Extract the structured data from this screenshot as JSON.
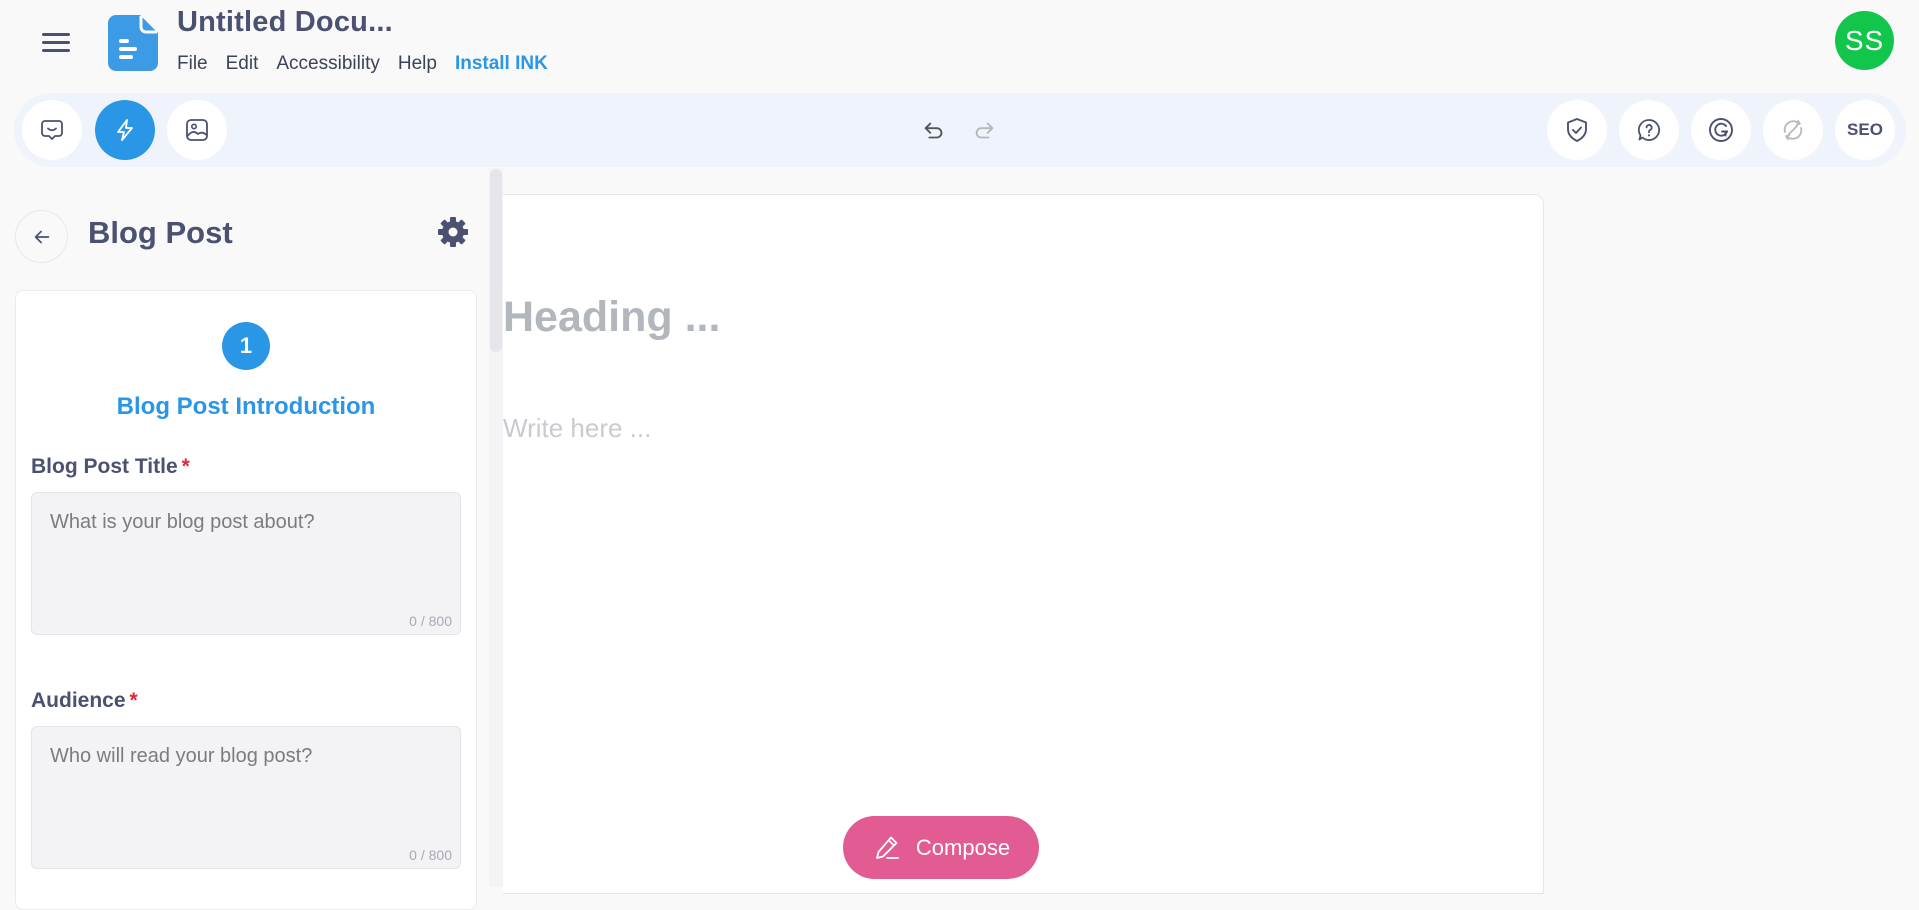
{
  "header": {
    "doc_title": "Untitled Docu...",
    "menu": [
      "File",
      "Edit",
      "Accessibility",
      "Help",
      "Install INK"
    ],
    "avatar_initials": "SS",
    "avatar_color": "#12c64b",
    "doc_icon": "document-icon"
  },
  "toolbar": {
    "left_buttons": [
      {
        "name": "chat-icon",
        "active": false
      },
      {
        "name": "lightning-icon",
        "active": true
      },
      {
        "name": "image-icon",
        "active": false
      }
    ],
    "center_buttons": [
      {
        "name": "undo-icon",
        "enabled": true
      },
      {
        "name": "redo-icon",
        "enabled": false
      }
    ],
    "right_buttons": [
      {
        "name": "shield-check-icon"
      },
      {
        "name": "help-bubble-icon"
      },
      {
        "name": "grammarly-icon"
      },
      {
        "name": "sync-disabled-icon"
      },
      {
        "name": "seo",
        "label": "SEO"
      }
    ],
    "accent_color": "#2a97e6"
  },
  "sidebar": {
    "title": "Blog Post",
    "step": {
      "number": "1",
      "title": "Blog Post Introduction"
    },
    "fields": [
      {
        "label": "Blog Post Title",
        "required_mark": "*",
        "value": "",
        "placeholder": "What is your blog post about?",
        "counter": "0 / 800"
      },
      {
        "label": "Audience",
        "required_mark": "*",
        "value": "",
        "placeholder": "Who will read your blog post?",
        "counter": "0 / 800"
      }
    ]
  },
  "editor": {
    "heading_placeholder": "Heading ...",
    "body_placeholder": "Write here ..."
  },
  "compose": {
    "label": "Compose",
    "color": "#e25c93"
  }
}
